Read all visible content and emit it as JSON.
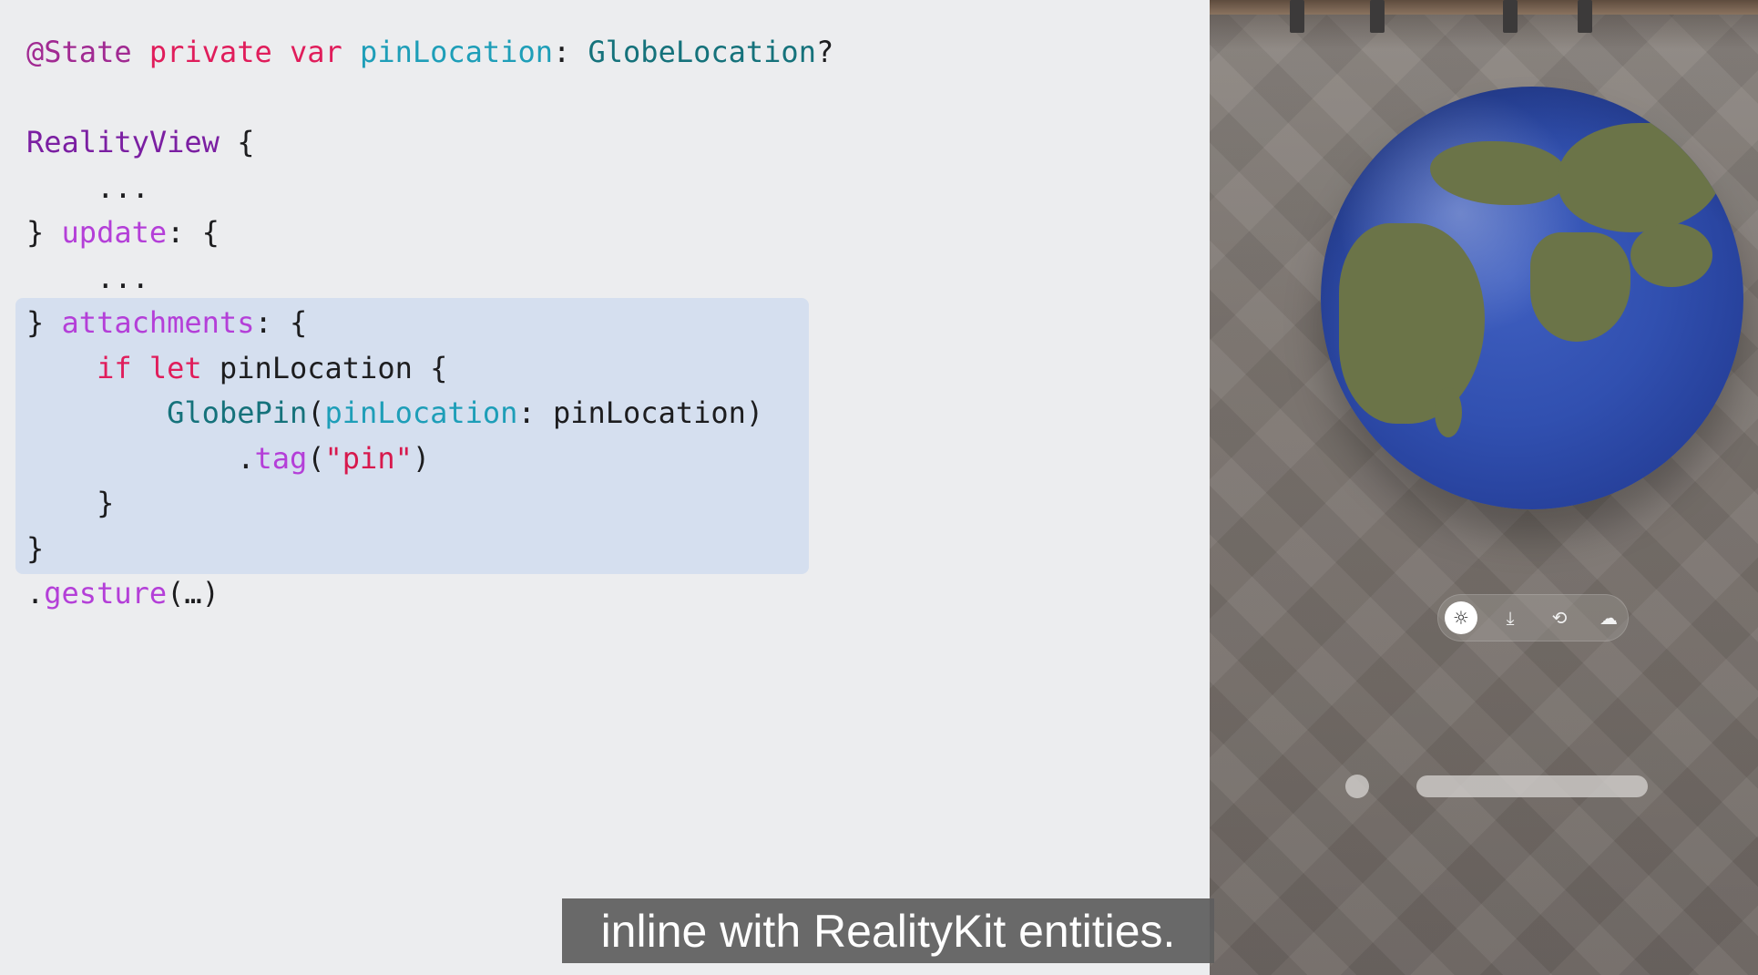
{
  "code": {
    "lines": [
      [
        {
          "t": "@State",
          "c": "attr"
        },
        {
          "t": " ",
          "c": "plain"
        },
        {
          "t": "private",
          "c": "kw"
        },
        {
          "t": " ",
          "c": "plain"
        },
        {
          "t": "var",
          "c": "kw"
        },
        {
          "t": " ",
          "c": "plain"
        },
        {
          "t": "pinLocation",
          "c": "prop"
        },
        {
          "t": ": ",
          "c": "plain"
        },
        {
          "t": "GlobeLocation",
          "c": "type"
        },
        {
          "t": "?",
          "c": "plain"
        }
      ],
      [],
      [
        {
          "t": "RealityView",
          "c": "func"
        },
        {
          "t": " {",
          "c": "plain"
        }
      ],
      [
        {
          "t": "    ...",
          "c": "plain"
        }
      ],
      [
        {
          "t": "} ",
          "c": "plain"
        },
        {
          "t": "update",
          "c": "lbl"
        },
        {
          "t": ": {",
          "c": "plain"
        }
      ],
      [
        {
          "t": "    ...",
          "c": "plain"
        }
      ],
      [
        {
          "t": "} ",
          "c": "plain"
        },
        {
          "t": "attachments",
          "c": "lbl"
        },
        {
          "t": ": {",
          "c": "plain"
        }
      ],
      [
        {
          "t": "    ",
          "c": "plain"
        },
        {
          "t": "if",
          "c": "kw"
        },
        {
          "t": " ",
          "c": "plain"
        },
        {
          "t": "let",
          "c": "kw"
        },
        {
          "t": " pinLocation {",
          "c": "plain"
        }
      ],
      [
        {
          "t": "        ",
          "c": "plain"
        },
        {
          "t": "GlobePin",
          "c": "type"
        },
        {
          "t": "(",
          "c": "plain"
        },
        {
          "t": "pinLocation",
          "c": "prop"
        },
        {
          "t": ": pinLocation)",
          "c": "plain"
        }
      ],
      [
        {
          "t": "            .",
          "c": "plain"
        },
        {
          "t": "tag",
          "c": "lbl"
        },
        {
          "t": "(",
          "c": "plain"
        },
        {
          "t": "\"pin\"",
          "c": "str"
        },
        {
          "t": ")",
          "c": "plain"
        }
      ],
      [
        {
          "t": "    }",
          "c": "plain"
        }
      ],
      [
        {
          "t": "}",
          "c": "plain"
        }
      ],
      [
        {
          "t": ".",
          "c": "plain"
        },
        {
          "t": "gesture",
          "c": "lbl"
        },
        {
          "t": "(…)",
          "c": "plain"
        }
      ]
    ]
  },
  "scene": {
    "ornament": {
      "buttons": [
        {
          "icon": "sun-icon",
          "glyph": "☼",
          "active": true
        },
        {
          "icon": "pin-drop-icon",
          "glyph": "⤓",
          "active": false
        },
        {
          "icon": "rotate-icon",
          "glyph": "⟲",
          "active": false
        },
        {
          "icon": "cloud-sun-icon",
          "glyph": "☁",
          "active": false
        }
      ]
    }
  },
  "caption": {
    "text": "inline with RealityKit entities."
  },
  "colors": {
    "attr": "#a12a92",
    "keyword": "#e01d5b",
    "property": "#1e9eb8",
    "type": "#15727b",
    "function": "#7b1fa2",
    "label": "#b43fd8",
    "string": "#d7194d",
    "highlight": "#d5dfef"
  }
}
